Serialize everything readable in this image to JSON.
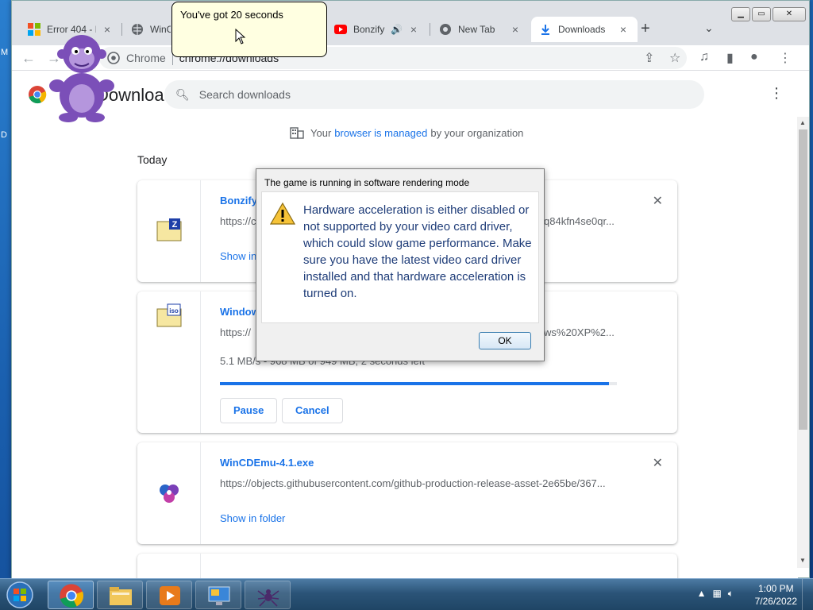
{
  "desktop": {
    "frag_left1": "M",
    "frag_left2": "D"
  },
  "browser": {
    "tabs": [
      {
        "label": "Error 404 - I",
        "icon": "microsoft-icon"
      },
      {
        "label": "WinC",
        "icon": "globe-icon"
      },
      {
        "label": "Bonzify",
        "icon": "youtube-icon",
        "audio": true
      },
      {
        "label": "New Tab",
        "icon": "chrome-icon"
      },
      {
        "label": "Downloads",
        "icon": "download-icon",
        "active": true
      }
    ],
    "tab_close": "×",
    "new_tab": "+",
    "omnibox": {
      "site": "Chrome",
      "url": "chrome://downloads"
    }
  },
  "downloads": {
    "title": "Downloads",
    "search_placeholder": "Search downloads",
    "managed_prefix": "Your",
    "managed_link": "browser is managed",
    "managed_suffix": "by your organization",
    "section": "Today",
    "items": [
      {
        "name": "Bonzify",
        "url": "https://c",
        "url_tail": "q84kfn4se0qr...",
        "link": "Show in"
      },
      {
        "name": "Window",
        "url": "https://",
        "url_tail": "ws%20XP%2...",
        "stats": "5.1 MB/s - 968 MB of 949 MB, 2 seconds left",
        "progress": 0.98,
        "pause": "Pause",
        "cancel": "Cancel"
      },
      {
        "name": "WinCDEmu-4.1.exe",
        "url": "https://objects.githubusercontent.com/github-production-release-asset-2e65be/367...",
        "link": "Show in folder"
      }
    ]
  },
  "dialog": {
    "title": "The game is running in software rendering mode",
    "message": "Hardware acceleration is either disabled or not supported by your video card driver, which could slow game performance. Make sure you have the latest video card driver installed and that hardware acceleration is turned on.",
    "ok": "OK"
  },
  "bonzi": {
    "bubble": "You've got 20 seconds"
  },
  "taskbar": {
    "time": "1:00 PM",
    "date": "7/26/2022"
  },
  "colors": {
    "accent": "#1a73e8",
    "dialog_text": "#1e3c78",
    "bonzi": "#7b4fb8"
  }
}
